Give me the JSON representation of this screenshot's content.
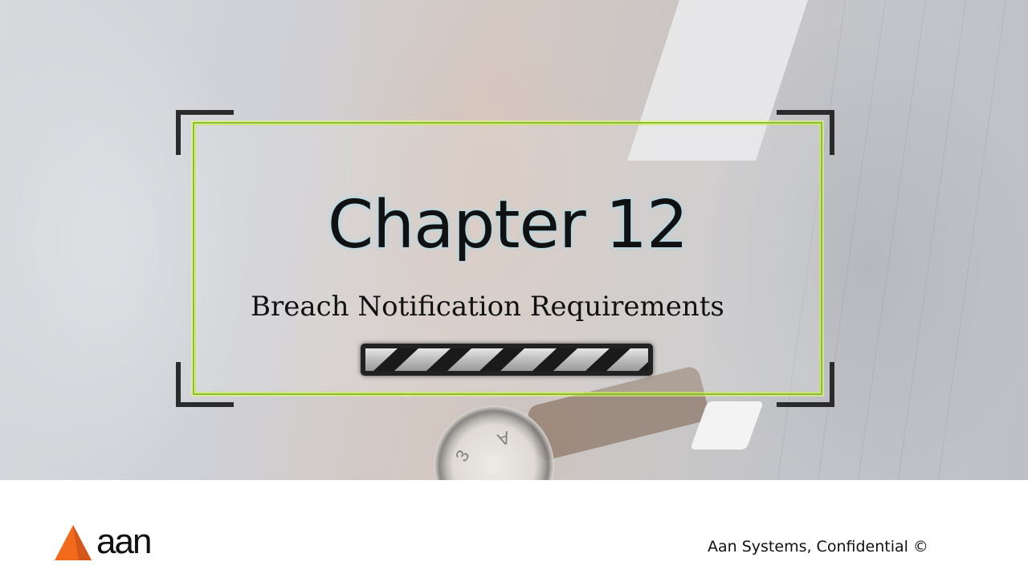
{
  "slide": {
    "title": "Chapter 12",
    "subtitle": "Breach Notification Requirements"
  },
  "footer": {
    "logo_text": "aan",
    "confidential_text": "Aan Systems, Confidential  ©"
  },
  "background": {
    "description_icon": "watch-photo",
    "watch_numerals": [
      "3",
      "A"
    ]
  },
  "colors": {
    "frame_accent": "#8cbd2a",
    "logo_orange": "#f26b1d",
    "corner_bracket": "#2b2b2b"
  }
}
